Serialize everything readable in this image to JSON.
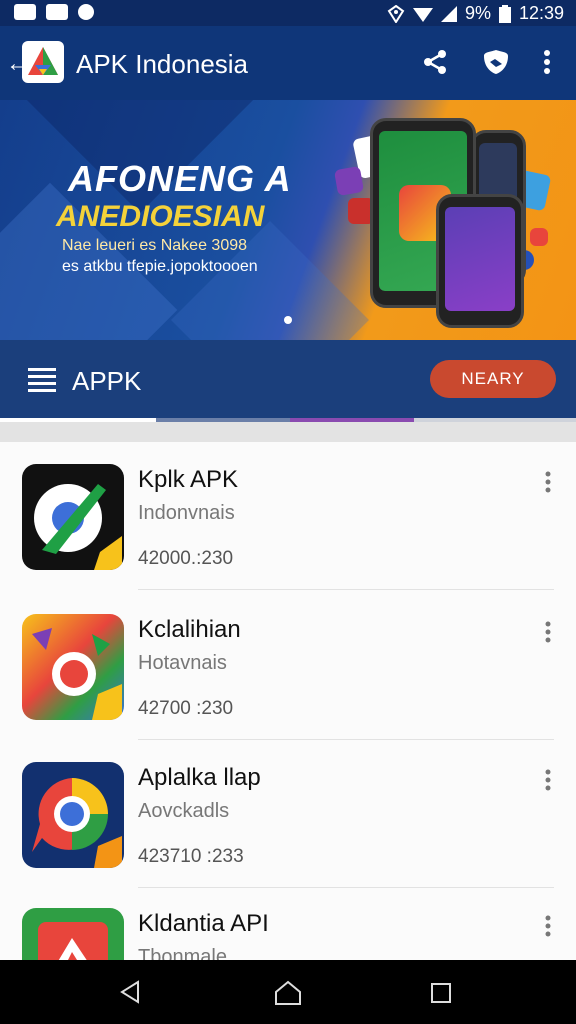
{
  "status_bar": {
    "battery": "9%",
    "time": "12:39"
  },
  "app_bar": {
    "title": "APK Indonesia",
    "icons": [
      "back-icon",
      "share-icon",
      "shield-icon",
      "more-icon"
    ]
  },
  "banner": {
    "headline": "AFONENG A",
    "subheadline": "ANEDIOESIAN",
    "line1": "Nae leueri es Nakee 3098",
    "line2": "es atkbu tfepie.jopoktoooen"
  },
  "sub_bar": {
    "title": "APPK",
    "nearby_button": "NEARY"
  },
  "apps": [
    {
      "name": "Kplk APK",
      "subtitle": "Indonvnais",
      "meta": "42000.:230"
    },
    {
      "name": "Kclalihian",
      "subtitle": "Hotavnais",
      "meta": "42700 :230"
    },
    {
      "name": "Aplalka llap",
      "subtitle": "Aovckadls",
      "meta": "423710 :233"
    },
    {
      "name": "Kldantia API",
      "subtitle": "Tbonmale",
      "meta": ""
    }
  ],
  "colors": {
    "app_bar": "#0f3679",
    "sub_bar": "#1b3f7c",
    "accent_button": "#c9492f",
    "banner_orange": "#f39415"
  }
}
